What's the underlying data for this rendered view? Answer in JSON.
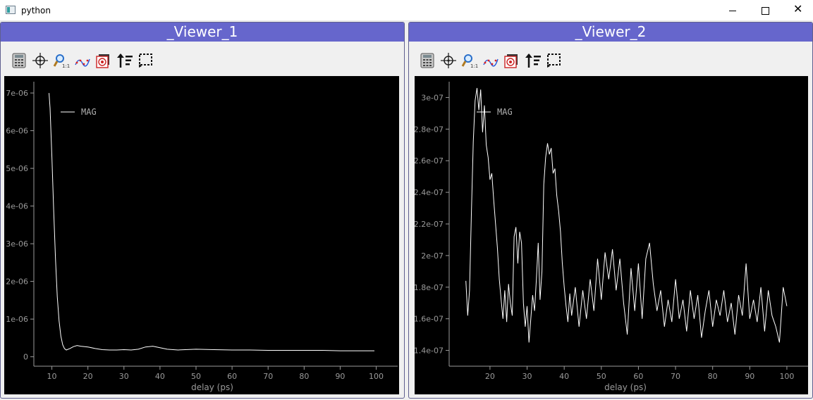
{
  "window": {
    "title": "python",
    "icon": "python-app-icon",
    "controls": [
      "minimize-icon",
      "maximize-icon",
      "close-icon"
    ],
    "close_glyph": "✕"
  },
  "toolbar_icons": [
    "calculator-icon",
    "crosshair-icon",
    "zoom-1to1-icon",
    "curve-fit-icon",
    "target-icon",
    "sort-icon",
    "rectangle-select-icon"
  ],
  "colors": {
    "header_bg": "#6666cc",
    "plot_bg": "#000000",
    "trace": "#ffffff",
    "axis": "#9a9a9a"
  },
  "viewers": [
    {
      "title": "_Viewer_1",
      "xlabel": "delay (ps)",
      "legend": "MAG",
      "yticks": [
        "7e-06",
        "6e-06",
        "5e-06",
        "4e-06",
        "3e-06",
        "2e-06",
        "1e-06",
        "0"
      ],
      "xticks": [
        "10",
        "20",
        "30",
        "40",
        "50",
        "60",
        "70",
        "80",
        "90",
        "100"
      ]
    },
    {
      "title": "_Viewer_2",
      "xlabel": "delay (ps)",
      "legend": "MAG",
      "yticks": [
        "3e-07",
        "2.8e-07",
        "2.6e-07",
        "2.4e-07",
        "2.2e-07",
        "2e-07",
        "1.8e-07",
        "1.6e-07",
        "1.4e-07"
      ],
      "xticks": [
        "20",
        "30",
        "40",
        "50",
        "60",
        "70",
        "80",
        "90",
        "100"
      ]
    }
  ],
  "chart_data": [
    {
      "type": "line",
      "title": "_Viewer_1",
      "xlabel": "delay (ps)",
      "ylabel": "",
      "xlim": [
        5,
        104
      ],
      "ylim": [
        -2.5e-07,
        7.3e-06
      ],
      "legend_placement": "top-left",
      "grid": false,
      "series": [
        {
          "name": "MAG",
          "x": [
            9.2,
            9.5,
            10,
            10.5,
            11,
            11.5,
            12,
            12.5,
            13,
            13.5,
            14,
            15,
            16,
            17,
            18,
            20,
            22,
            24,
            26,
            28,
            30,
            32,
            34,
            36,
            38,
            40,
            42,
            45,
            50,
            55,
            60,
            65,
            70,
            75,
            80,
            85,
            90,
            95,
            99.5
          ],
          "y": [
            7e-06,
            6.6e-06,
            5.3e-06,
            3.9e-06,
            2.6e-06,
            1.6e-06,
            9.5e-07,
            5.5e-07,
            3.2e-07,
            2.2e-07,
            1.8e-07,
            2.2e-07,
            2.7e-07,
            3e-07,
            2.8e-07,
            2.6e-07,
            2.2e-07,
            1.9e-07,
            1.8e-07,
            1.8e-07,
            1.9e-07,
            1.8e-07,
            2e-07,
            2.6e-07,
            2.8e-07,
            2.4e-07,
            2e-07,
            1.8e-07,
            2e-07,
            1.9e-07,
            1.8e-07,
            1.8e-07,
            1.7e-07,
            1.7e-07,
            1.7e-07,
            1.7e-07,
            1.6e-07,
            1.6e-07,
            1.6e-07
          ]
        }
      ]
    },
    {
      "type": "line",
      "title": "_Viewer_2",
      "xlabel": "delay (ps)",
      "ylabel": "",
      "xlim": [
        9,
        104
      ],
      "ylim": [
        1.3e-07,
        3.1e-07
      ],
      "legend_placement": "top-left",
      "grid": false,
      "series": [
        {
          "name": "MAG",
          "x": [
            13.5,
            14,
            14.5,
            15,
            15.5,
            16,
            16.5,
            17,
            17.5,
            18,
            18.5,
            19,
            19.5,
            20,
            20.5,
            21,
            21.5,
            22,
            22.5,
            23,
            23.5,
            24,
            24.5,
            25,
            25.5,
            26,
            26.5,
            27,
            27.5,
            28,
            28.5,
            29,
            29.5,
            30,
            30.5,
            31,
            31.5,
            32,
            32.5,
            33,
            33.5,
            34,
            34.5,
            35,
            35.5,
            36,
            36.5,
            37,
            37.5,
            38,
            38.5,
            39,
            39.5,
            40,
            40.5,
            41,
            41.5,
            42,
            43,
            44,
            45,
            46,
            47,
            48,
            49,
            50,
            51,
            52,
            53,
            54,
            55,
            56,
            57,
            58,
            59,
            60,
            61,
            62,
            63,
            64,
            65,
            66,
            67,
            68,
            69,
            70,
            71,
            72,
            73,
            74,
            75,
            76,
            77,
            78,
            79,
            80,
            81,
            82,
            83,
            84,
            85,
            86,
            87,
            88,
            89,
            90,
            91,
            92,
            93,
            94,
            95,
            96,
            97,
            98,
            99,
            100
          ],
          "y": [
            1.84e-07,
            1.62e-07,
            1.78e-07,
            2.28e-07,
            2.72e-07,
            2.98e-07,
            3.06e-07,
            2.92e-07,
            3.05e-07,
            2.78e-07,
            2.95e-07,
            2.7e-07,
            2.62e-07,
            2.48e-07,
            2.52e-07,
            2.35e-07,
            2.2e-07,
            2.05e-07,
            1.85e-07,
            1.72e-07,
            1.6e-07,
            1.78e-07,
            1.58e-07,
            1.82e-07,
            1.7e-07,
            1.62e-07,
            2.12e-07,
            2.18e-07,
            1.95e-07,
            2.15e-07,
            2.08e-07,
            1.7e-07,
            1.55e-07,
            1.68e-07,
            1.45e-07,
            1.6e-07,
            1.75e-07,
            1.65e-07,
            1.85e-07,
            2.08e-07,
            1.72e-07,
            1.9e-07,
            2.45e-07,
            2.62e-07,
            2.71e-07,
            2.64e-07,
            2.68e-07,
            2.52e-07,
            2.55e-07,
            2.38e-07,
            2.28e-07,
            2.15e-07,
            1.95e-07,
            1.8e-07,
            1.68e-07,
            1.58e-07,
            1.76e-07,
            1.62e-07,
            1.8e-07,
            1.55e-07,
            1.78e-07,
            1.6e-07,
            1.85e-07,
            1.65e-07,
            1.98e-07,
            1.72e-07,
            2.02e-07,
            1.85e-07,
            2.04e-07,
            1.78e-07,
            1.98e-07,
            1.7e-07,
            1.5e-07,
            1.92e-07,
            1.65e-07,
            1.95e-07,
            1.6e-07,
            1.98e-07,
            2.08e-07,
            1.82e-07,
            1.65e-07,
            1.78e-07,
            1.55e-07,
            1.72e-07,
            1.58e-07,
            1.85e-07,
            1.6e-07,
            1.72e-07,
            1.52e-07,
            1.78e-07,
            1.6e-07,
            1.75e-07,
            1.48e-07,
            1.65e-07,
            1.78e-07,
            1.55e-07,
            1.72e-07,
            1.62e-07,
            1.78e-07,
            1.58e-07,
            1.7e-07,
            1.5e-07,
            1.75e-07,
            1.62e-07,
            1.95e-07,
            1.6e-07,
            1.72e-07,
            1.58e-07,
            1.8e-07,
            1.52e-07,
            1.78e-07,
            1.62e-07,
            1.55e-07,
            1.45e-07,
            1.8e-07,
            1.68e-07
          ]
        }
      ]
    }
  ]
}
